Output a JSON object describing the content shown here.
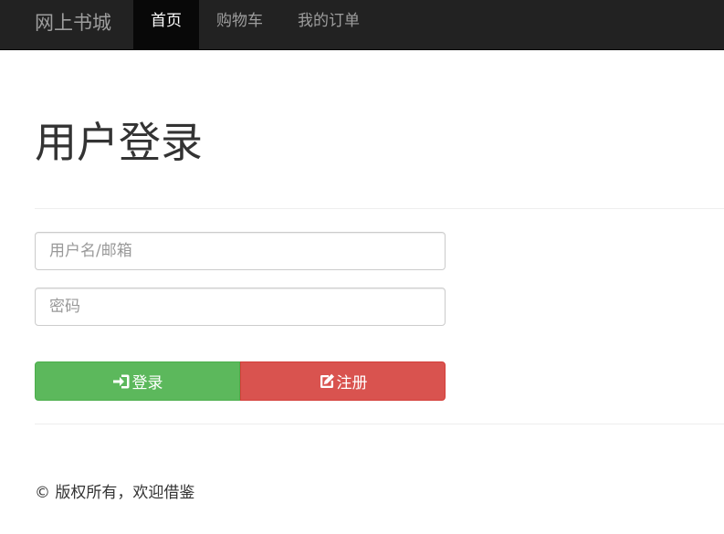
{
  "navbar": {
    "brand": "网上书城",
    "items": [
      {
        "label": "首页",
        "active": true
      },
      {
        "label": "购物车",
        "active": false
      },
      {
        "label": "我的订单",
        "active": false
      }
    ]
  },
  "main": {
    "title": "用户登录",
    "username": {
      "value": "",
      "placeholder": "用户名/邮箱"
    },
    "password": {
      "value": "",
      "placeholder": "密码"
    },
    "login_button": {
      "label": "登录",
      "icon": "log-in-icon",
      "color": "#5cb85c"
    },
    "register_button": {
      "label": "注册",
      "icon": "edit-icon",
      "color": "#d9534f"
    }
  },
  "footer": {
    "text": "© 版权所有，欢迎借鉴"
  }
}
